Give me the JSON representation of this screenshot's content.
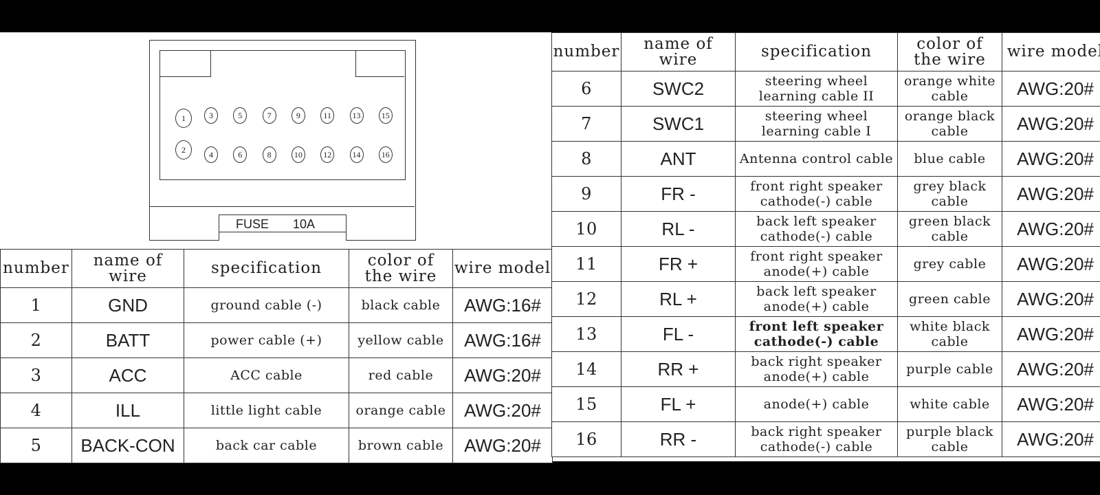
{
  "connector": {
    "pins_top": [
      "1",
      "3",
      "5",
      "7",
      "9",
      "11",
      "13",
      "15"
    ],
    "pins_bottom": [
      "2",
      "4",
      "6",
      "8",
      "10",
      "12",
      "14",
      "16"
    ],
    "fuse_label": "FUSE",
    "fuse_value": "10A"
  },
  "headers": {
    "number": "number",
    "name": "name of wire",
    "spec": "specification",
    "color": "color of the wire",
    "model": "wire model"
  },
  "rows": [
    {
      "number": "1",
      "name": "GND",
      "spec": "ground cable (-)",
      "color": "black cable",
      "model": "AWG:16#"
    },
    {
      "number": "2",
      "name": "BATT",
      "spec": "power cable (+)",
      "color": "yellow cable",
      "model": "AWG:16#"
    },
    {
      "number": "3",
      "name": "ACC",
      "spec": "ACC cable",
      "color": "red cable",
      "model": "AWG:20#"
    },
    {
      "number": "4",
      "name": "ILL",
      "spec": "little light cable",
      "color": "orange cable",
      "model": "AWG:20#"
    },
    {
      "number": "5",
      "name": "BACK-CON",
      "spec": "back car cable",
      "color": "brown cable",
      "model": "AWG:20#"
    },
    {
      "number": "6",
      "name": "SWC2",
      "spec": "steering wheel learning cable II",
      "color": "orange white cable",
      "model": "AWG:20#"
    },
    {
      "number": "7",
      "name": "SWC1",
      "spec": "steering wheel learning cable I",
      "color": "orange black cable",
      "model": "AWG:20#"
    },
    {
      "number": "8",
      "name": "ANT",
      "spec": "Antenna control cable",
      "color": "blue cable",
      "model": "AWG:20#"
    },
    {
      "number": "9",
      "name": "FR -",
      "spec": "front right speaker cathode(-) cable",
      "color": "grey black cable",
      "model": "AWG:20#"
    },
    {
      "number": "10",
      "name": "RL -",
      "spec": "back left speaker cathode(-) cable",
      "color": "green black cable",
      "model": "AWG:20#"
    },
    {
      "number": "11",
      "name": "FR +",
      "spec": "front right speaker anode(+) cable",
      "color": "grey cable",
      "model": "AWG:20#"
    },
    {
      "number": "12",
      "name": "RL +",
      "spec": "back left speaker anode(+) cable",
      "color": "green cable",
      "model": "AWG:20#"
    },
    {
      "number": "13",
      "name": "FL -",
      "spec": "front left speaker cathode(-) cable",
      "color": "white black cable",
      "model": "AWG:20#"
    },
    {
      "number": "14",
      "name": "RR +",
      "spec": "back right speaker anode(+) cable",
      "color": "purple cable",
      "model": "AWG:20#"
    },
    {
      "number": "15",
      "name": "FL +",
      "spec": "anode(+) cable",
      "color": "white cable",
      "model": "AWG:20#"
    },
    {
      "number": "16",
      "name": "RR -",
      "spec": "back right speaker cathode(-) cable",
      "color": "purple black cable",
      "model": "AWG:20#"
    }
  ]
}
